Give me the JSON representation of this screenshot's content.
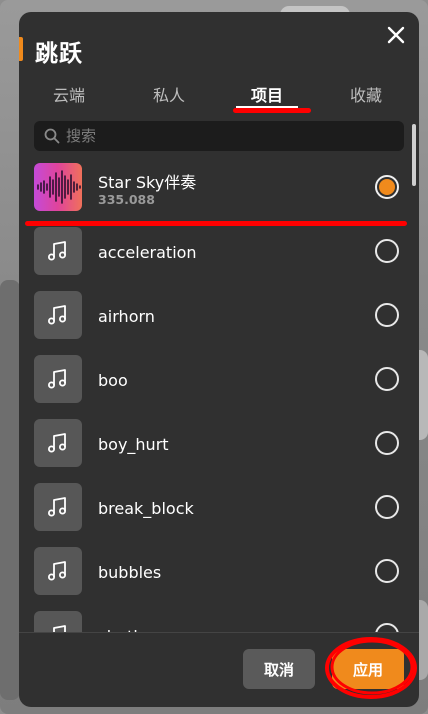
{
  "dialog": {
    "title": "跳跃"
  },
  "tabs": [
    {
      "label": "云端",
      "active": false
    },
    {
      "label": "私人",
      "active": false
    },
    {
      "label": "项目",
      "active": true
    },
    {
      "label": "收藏",
      "active": false
    }
  ],
  "search": {
    "placeholder": "搜索",
    "value": ""
  },
  "items": [
    {
      "name": "Star Sky伴奏",
      "subtitle": "335.088",
      "selected": true,
      "icon": "album-art-waveform"
    },
    {
      "name": "acceleration",
      "selected": false,
      "icon": "music-note-icon"
    },
    {
      "name": "airhorn",
      "selected": false,
      "icon": "music-note-icon"
    },
    {
      "name": "boo",
      "selected": false,
      "icon": "music-note-icon"
    },
    {
      "name": "boy_hurt",
      "selected": false,
      "icon": "music-note-icon"
    },
    {
      "name": "break_block",
      "selected": false,
      "icon": "music-note-icon"
    },
    {
      "name": "bubbles",
      "selected": false,
      "icon": "music-note-icon"
    },
    {
      "name": "chuth",
      "selected": false,
      "icon": "music-note-icon"
    }
  ],
  "footer": {
    "cancel_label": "取消",
    "apply_label": "应用"
  },
  "colors": {
    "accent": "#f08a1c",
    "dialog_bg": "#303030",
    "annotation": "#ff0000"
  }
}
